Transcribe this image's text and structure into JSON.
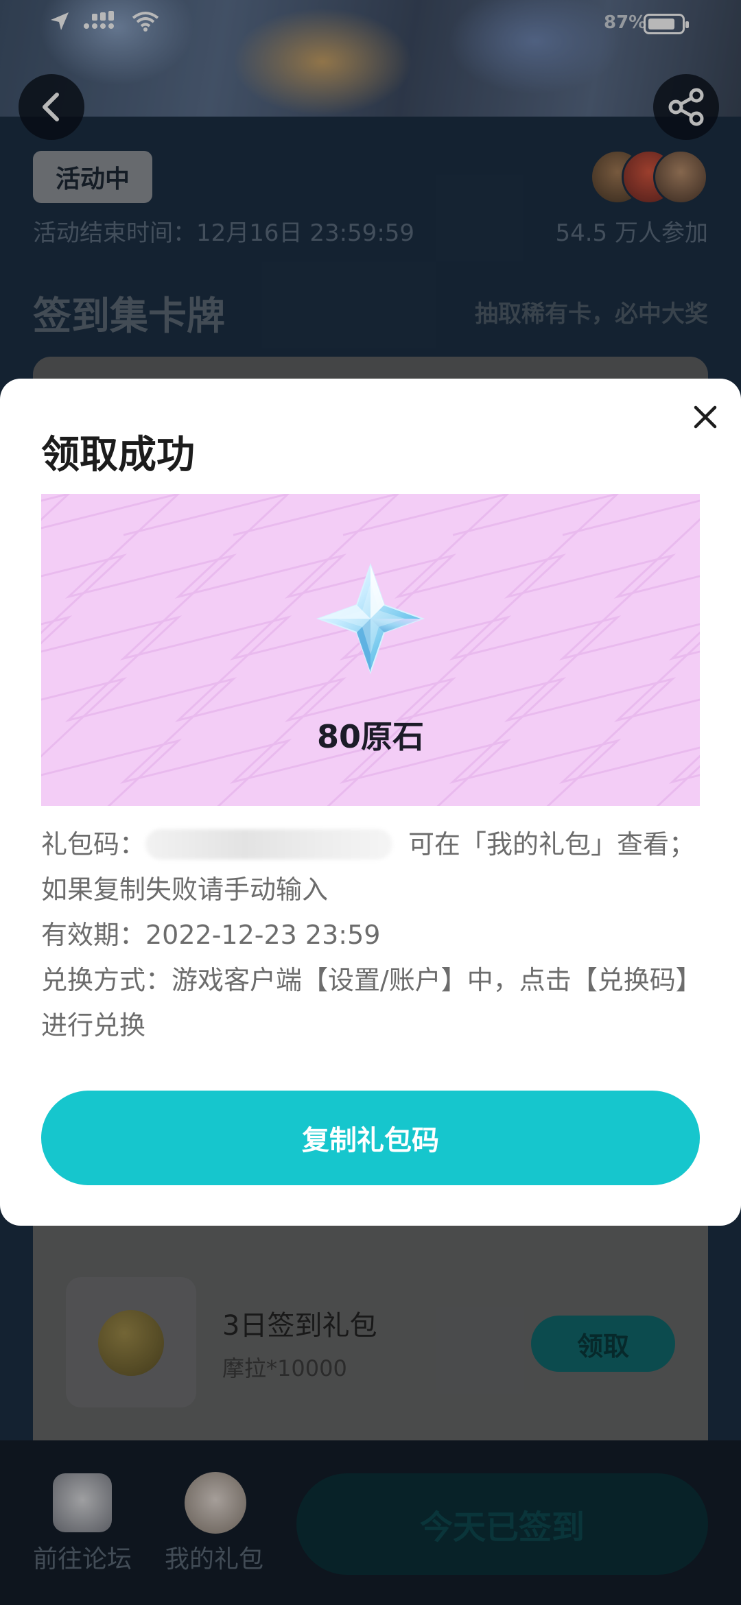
{
  "status_bar": {
    "battery_percent": "87%",
    "battery_level": 0.87
  },
  "event": {
    "status_tag": "活动中",
    "end_time": "活动结束时间：12月16日 23:59:59",
    "participants": "54.5 万人参加",
    "section_title": "签到集卡牌",
    "section_subtitle": "抽取稀有卡，必中大奖"
  },
  "reward_item": {
    "name": "3日签到礼包",
    "desc": "摩拉*10000",
    "claim_label": "领取"
  },
  "bottom_nav": {
    "forum_label": "前往论坛",
    "gift_label": "我的礼包",
    "signed_label": "今天已签到"
  },
  "dialog": {
    "title": "领取成功",
    "prize_name": "80原石",
    "code_prefix": "礼包码：",
    "code_suffix": "可在「我的礼包」查看；如果复制失败请手动输入",
    "validity": "有效期：2022-12-23 23:59",
    "redeem_method": "兑换方式：游戏客户端【设置/账户】中，点击【兑换码】进行兑换",
    "copy_button": "复制礼包码"
  },
  "colors": {
    "accent": "#16c6cd",
    "prize_bg": "#f3cdf6"
  },
  "icons": {
    "back": "back-arrow-icon",
    "share": "share-icon",
    "close": "close-icon",
    "prize": "primogem-icon"
  }
}
